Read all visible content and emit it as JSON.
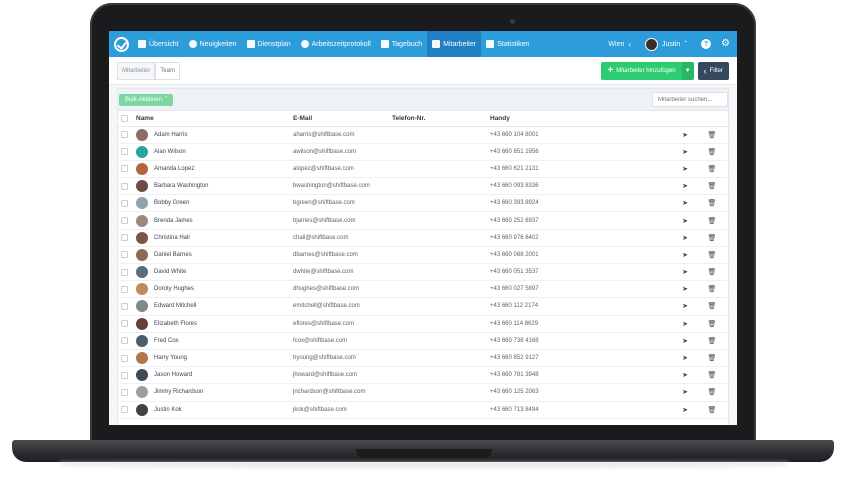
{
  "nav": {
    "items": [
      {
        "label": "Übersicht",
        "icon": "grid-icon"
      },
      {
        "label": "Neuigkeiten",
        "icon": "chat-icon"
      },
      {
        "label": "Dienstplan",
        "icon": "calendar-icon"
      },
      {
        "label": "Arbeitszeitprotokoll",
        "icon": "clock-icon"
      },
      {
        "label": "Tagebuch",
        "icon": "book-icon"
      },
      {
        "label": "Mitarbeiter",
        "icon": "users-icon"
      },
      {
        "label": "Statistiken",
        "icon": "bar-chart-icon"
      }
    ],
    "location": "Wien",
    "user": "Justin",
    "help": "?",
    "accent": "#2d9cdb"
  },
  "subbar": {
    "tabs": [
      "Mitarbeiter",
      "Team"
    ],
    "add_button": "Mitarbeiter hinzufügen",
    "filter_button": "Filter"
  },
  "toolbar": {
    "bulk": "Bulk-Aktionen",
    "search_placeholder": "Mitarbeiter suchen..."
  },
  "table": {
    "headers": {
      "name": "Name",
      "email": "E-Mail",
      "tel": "Telefon-Nr.",
      "handy": "Handy"
    },
    "rows": [
      {
        "name": "Adam Harris",
        "email": "aharris@shiftbase.com",
        "handy": "+43 660 104 8001",
        "avatar": "#8d6e63"
      },
      {
        "name": "Alan Wilson",
        "email": "awilson@shiftbase.com",
        "handy": "+43 660 851 1956",
        "avatar": "#26a69a"
      },
      {
        "name": "Amanda Lopez",
        "email": "alopez@shiftbase.com",
        "handy": "+43 660 621 2131",
        "avatar": "#b5643f"
      },
      {
        "name": "Barbara Washington",
        "email": "bwashington@shiftbase.com",
        "handy": "+43 660 093 8336",
        "avatar": "#6d4c41"
      },
      {
        "name": "Bobby Green",
        "email": "bgreen@shiftbase.com",
        "handy": "+43 660 393 8924",
        "avatar": "#90a4ae"
      },
      {
        "name": "Brenda James",
        "email": "bjames@shiftbase.com",
        "handy": "+43 660 252 6937",
        "avatar": "#a1887f"
      },
      {
        "name": "Christina Hall",
        "email": "chall@shiftbase.com",
        "handy": "+43 660 976 6402",
        "avatar": "#795548"
      },
      {
        "name": "Daniel Barnes",
        "email": "dbarnes@shiftbase.com",
        "handy": "+43 660 088 2001",
        "avatar": "#8c6a55"
      },
      {
        "name": "David White",
        "email": "dwhite@shiftbase.com",
        "handy": "+43 660 051 3537",
        "avatar": "#5d6d7e"
      },
      {
        "name": "Doroty Hughes",
        "email": "dhughes@shiftbase.com",
        "handy": "+43 660 027 5897",
        "avatar": "#c08a5d"
      },
      {
        "name": "Edward Mitchell",
        "email": "emitchell@shiftbase.com",
        "handy": "+43 660 112 2174",
        "avatar": "#7b8a8b"
      },
      {
        "name": "Elizabeth Flores",
        "email": "eflores@shiftbase.com",
        "handy": "+43 660 114 8629",
        "avatar": "#6a3f35"
      },
      {
        "name": "Fred Cox",
        "email": "fcox@shiftbase.com",
        "handy": "+43 660 738 4168",
        "avatar": "#4e5d6c"
      },
      {
        "name": "Harry Young",
        "email": "hyoung@shiftbase.com",
        "handy": "+43 660 852 9127",
        "avatar": "#b0764e"
      },
      {
        "name": "Jason Howard",
        "email": "jhoward@shiftbase.com",
        "handy": "+43 660 781 3948",
        "avatar": "#3e4a55"
      },
      {
        "name": "Jimmy Richardson",
        "email": "jrichardson@shiftbase.com",
        "handy": "+43 660 125 2063",
        "avatar": "#9e9e9e"
      },
      {
        "name": "Justin Kok",
        "email": "jkok@shiftbase.com",
        "handy": "+43 660 713 8494",
        "avatar": "#424242"
      }
    ]
  }
}
